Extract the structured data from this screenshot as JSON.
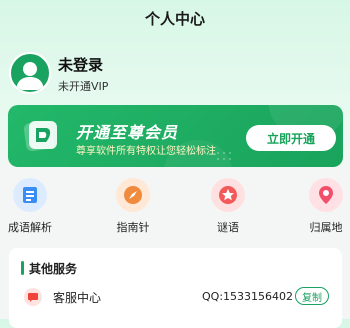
{
  "header": {
    "title": "个人中心"
  },
  "user": {
    "name": "未登录",
    "vip_status": "未开通VIP"
  },
  "banner": {
    "title": "开通至尊会员",
    "subtitle": "尊享软件所有特权让您轻松标注",
    "button_label": "立即开通"
  },
  "tools": [
    {
      "label": "成语解析",
      "icon": "book-icon",
      "color": "#3b8df6",
      "bg": "#dcebff"
    },
    {
      "label": "指南针",
      "icon": "compass-icon",
      "color": "#f08a3c",
      "bg": "#ffe8d6"
    },
    {
      "label": "谜语",
      "icon": "star-icon",
      "color": "#f25a5a",
      "bg": "#ffe0e0"
    },
    {
      "label": "归属地",
      "icon": "location-pin-icon",
      "color": "#f2506a",
      "bg": "#ffe0e5"
    }
  ],
  "services": {
    "title": "其他服务",
    "items": [
      {
        "label": "客服中心",
        "icon": "chat-bubble-icon",
        "detail": "QQ:1533156402",
        "action_label": "复制"
      }
    ]
  },
  "colors": {
    "primary": "#1aa260",
    "banner": "#22b86a",
    "background": "#f4f6f5"
  }
}
